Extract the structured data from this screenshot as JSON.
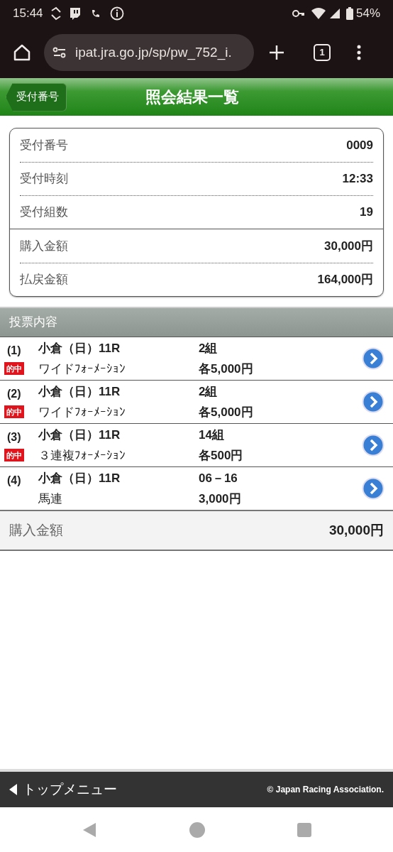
{
  "status_bar": {
    "time": "15:44",
    "battery": "54%"
  },
  "browser": {
    "url": "ipat.jra.go.jp/sp/pw_752_i.",
    "tab_count": "1"
  },
  "header": {
    "back_button": "受付番号",
    "title": "照会結果一覧"
  },
  "summary": {
    "groups": [
      [
        {
          "label": "受付番号",
          "value": "0009"
        },
        {
          "label": "受付時刻",
          "value": "12:33"
        },
        {
          "label": "受付組数",
          "value": "19"
        }
      ],
      [
        {
          "label": "購入金額",
          "value": "30,000円"
        },
        {
          "label": "払戻金額",
          "value": "164,000円"
        }
      ]
    ]
  },
  "bets": {
    "title": "投票内容",
    "rows": [
      {
        "number": "(1)",
        "race": "小倉（日）11R",
        "hit": true,
        "badge": "的中",
        "type": "ワイドﾌｫｰﾒｰｼｮﾝ",
        "count": "2組",
        "amount": "各5,000円"
      },
      {
        "number": "(2)",
        "race": "小倉（日）11R",
        "hit": true,
        "badge": "的中",
        "type": "ワイドﾌｫｰﾒｰｼｮﾝ",
        "count": "2組",
        "amount": "各5,000円"
      },
      {
        "number": "(3)",
        "race": "小倉（日）11R",
        "hit": true,
        "badge": "的中",
        "type": "３連複ﾌｫｰﾒｰｼｮﾝ",
        "count": "14組",
        "amount": "各500円"
      },
      {
        "number": "(4)",
        "race": "小倉（日）11R",
        "hit": false,
        "type": "馬連",
        "count": "06－16",
        "amount": "3,000円"
      }
    ],
    "total_label": "購入金額",
    "total_value": "30,000円"
  },
  "footer": {
    "menu_link": "トップメニュー",
    "copyright": "© Japan Racing Association."
  }
}
